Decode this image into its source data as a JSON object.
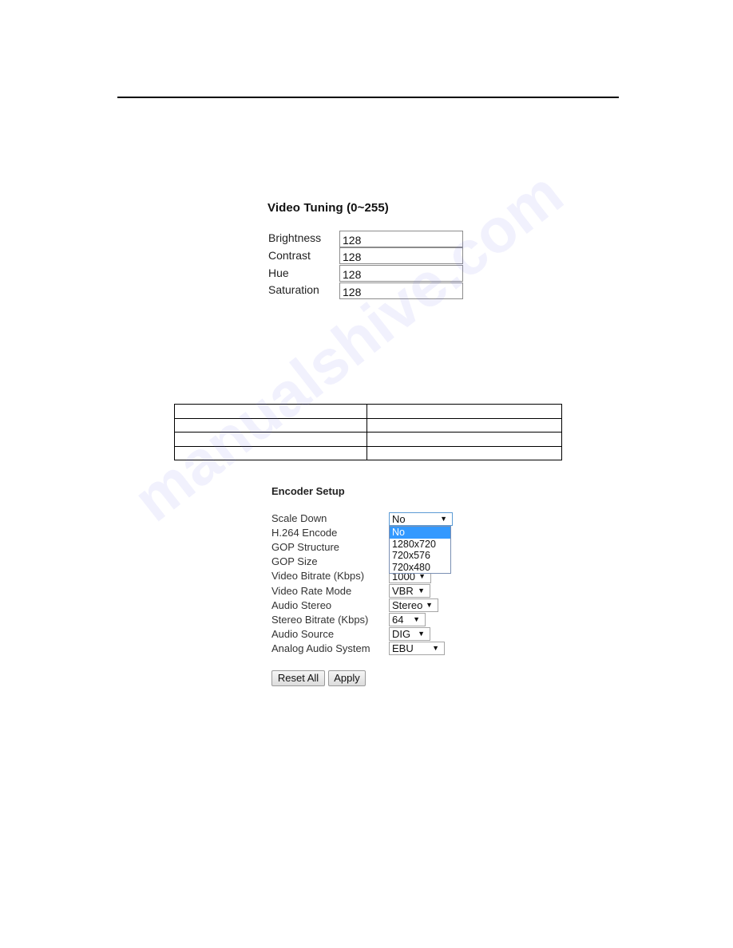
{
  "watermark": "manualshive.com",
  "video_tuning": {
    "title": "Video Tuning (0~255)",
    "fields": [
      {
        "label": "Brightness",
        "value": "128"
      },
      {
        "label": "Contrast",
        "value": "128"
      },
      {
        "label": "Hue",
        "value": "128"
      },
      {
        "label": "Saturation",
        "value": "128"
      }
    ]
  },
  "empty_table": {
    "rows": 4,
    "columns": 2
  },
  "encoder_setup": {
    "title": "Encoder Setup",
    "fields": [
      {
        "label": "Scale Down",
        "value": "No"
      },
      {
        "label": "H.264 Encode",
        "value": ""
      },
      {
        "label": "GOP Structure",
        "value": ""
      },
      {
        "label": "GOP Size",
        "value": ""
      },
      {
        "label": "Video Bitrate (Kbps)",
        "value": "1000"
      },
      {
        "label": "Video Rate Mode",
        "value": "VBR"
      },
      {
        "label": "Audio Stereo",
        "value": "Stereo"
      },
      {
        "label": "Stereo Bitrate (Kbps)",
        "value": "64"
      },
      {
        "label": "Audio Source",
        "value": "DIG"
      },
      {
        "label": "Analog Audio System",
        "value": "EBU"
      }
    ],
    "scale_down_dropdown": {
      "options": [
        "No",
        "1280x720",
        "720x576",
        "720x480"
      ],
      "highlighted": "No",
      "highlight_color": "#3399ff"
    },
    "buttons": {
      "reset_all": "Reset All",
      "apply": "Apply"
    }
  }
}
